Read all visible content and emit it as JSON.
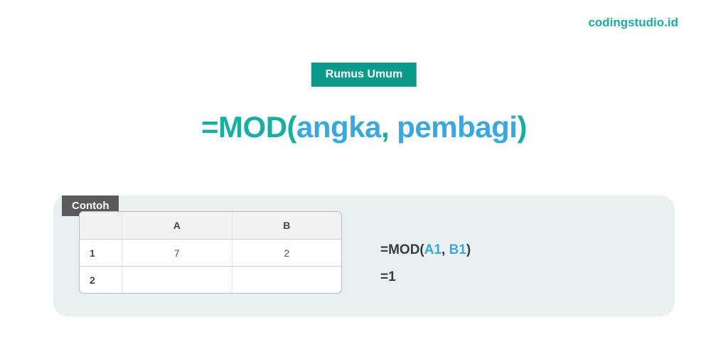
{
  "brand": "codingstudio.id",
  "badge": "Rumus Umum",
  "formula": {
    "eq": "=",
    "fn": "MOD",
    "open": "(",
    "arg1": "angka",
    "comma": ", ",
    "arg2": "pembagi",
    "close": ")"
  },
  "example": {
    "label": "Contoh",
    "headers": {
      "blank": "",
      "colA": "A",
      "colB": "B"
    },
    "rows": [
      {
        "n": "1",
        "a": "7",
        "b": "2"
      },
      {
        "n": "2",
        "a": "",
        "b": ""
      }
    ],
    "line1": {
      "pre": "=MOD(",
      "r1": "A1",
      "mid": ", ",
      "r2": "B1",
      "post": ")"
    },
    "line2": "=1"
  }
}
